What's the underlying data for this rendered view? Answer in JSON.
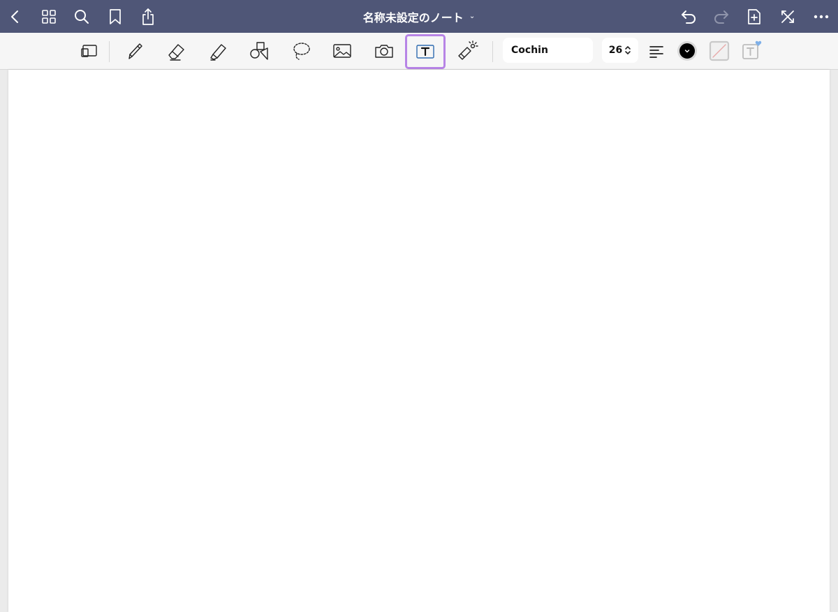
{
  "app": {
    "title": "名称未設定のノート",
    "title_chevron": "⌄"
  },
  "topbar": {
    "left": [
      "back-icon",
      "grid-icon",
      "search-icon",
      "bookmark-icon",
      "share-icon"
    ],
    "right": [
      "undo-icon",
      "redo-icon",
      "add-page-icon",
      "close-fullscreen-icon",
      "more-icon"
    ]
  },
  "toolbar": {
    "tools": [
      "page-thumbnail-icon",
      "pen-icon",
      "eraser-icon",
      "highlighter-icon",
      "shapes-icon",
      "lasso-icon",
      "image-icon",
      "camera-icon",
      "text-box-icon",
      "laser-pointer-icon"
    ],
    "selected_tool": "text-box-icon",
    "font_name": "Cochin",
    "font_size": "26",
    "text_color": "#000000",
    "accent_color": "#b784e6",
    "topbar_color": "#4f5677"
  }
}
